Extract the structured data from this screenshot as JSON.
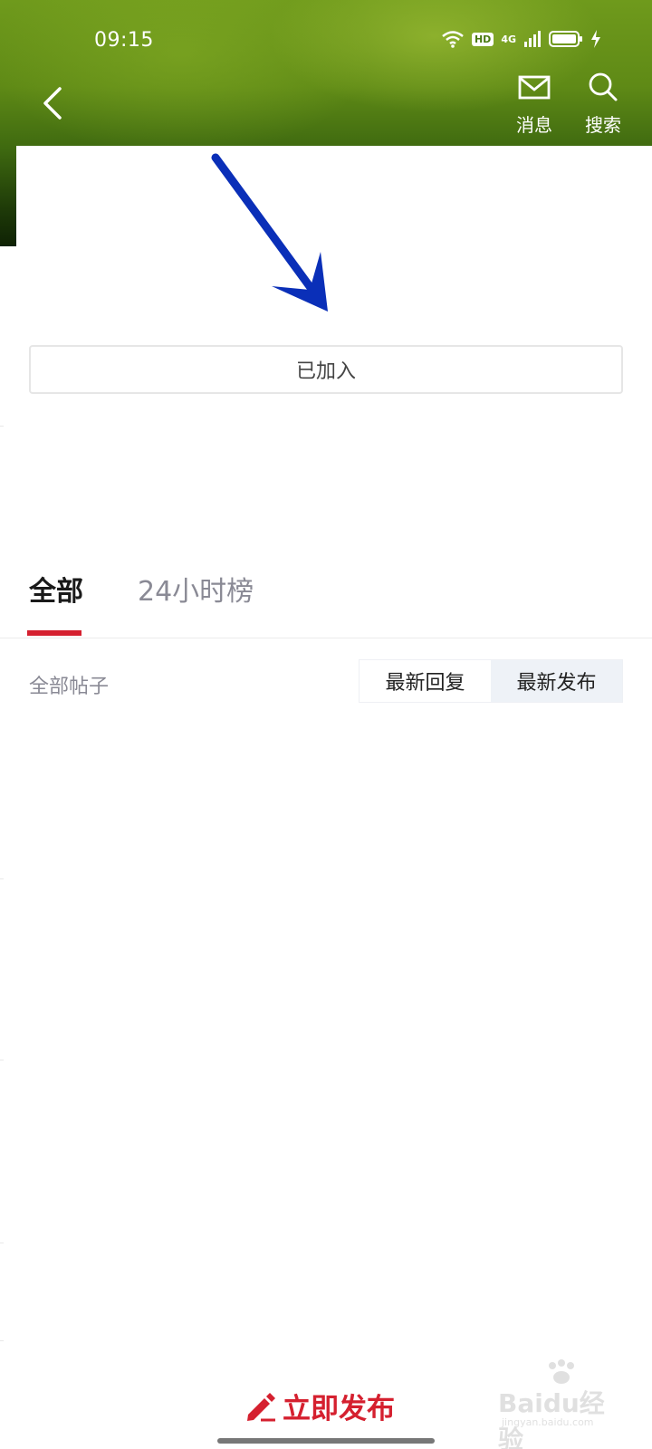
{
  "status_bar": {
    "time": "09:15",
    "hd_badge": "HD",
    "network": "4G",
    "icons": [
      "wifi-icon",
      "hd-icon",
      "signal-icon",
      "battery-icon",
      "charging-icon"
    ]
  },
  "nav": {
    "back_icon": "back-chevron-icon",
    "messages_label": "消息",
    "messages_icon": "envelope-icon",
    "search_label": "搜索",
    "search_icon": "search-icon"
  },
  "join_button": {
    "label": "已加入"
  },
  "tabs": [
    {
      "label": "全部",
      "active": true
    },
    {
      "label": "24小时榜",
      "active": false
    }
  ],
  "filter": {
    "posts_label": "全部帖子",
    "sort_options": [
      {
        "label": "最新回复",
        "selected": false
      },
      {
        "label": "最新发布",
        "selected": true
      }
    ]
  },
  "publish": {
    "label": "立即发布",
    "icon": "pencil-icon"
  },
  "watermark": {
    "text": "Baidu经验",
    "sub": "jingyan.baidu.com"
  },
  "colors": {
    "accent": "#d5202f",
    "annotation_arrow": "#0a2fb8",
    "header_green": "#5f8a16"
  }
}
